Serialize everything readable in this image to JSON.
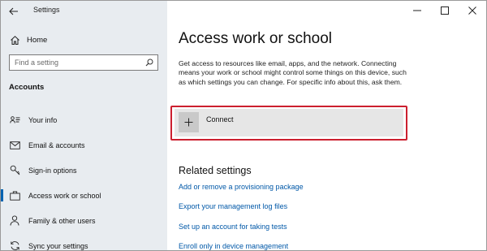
{
  "app": {
    "title": "Settings"
  },
  "sidebar": {
    "home_label": "Home",
    "search": {
      "placeholder": "Find a setting"
    },
    "section_title": "Accounts",
    "items": [
      {
        "label": "Your info",
        "icon": "contact-card-icon"
      },
      {
        "label": "Email & accounts",
        "icon": "mail-icon"
      },
      {
        "label": "Sign-in options",
        "icon": "key-icon"
      },
      {
        "label": "Access work or school",
        "icon": "briefcase-icon",
        "active": true
      },
      {
        "label": "Family & other users",
        "icon": "person-icon"
      },
      {
        "label": "Sync your settings",
        "icon": "sync-icon"
      }
    ]
  },
  "main": {
    "title": "Access work or school",
    "description": "Get access to resources like email, apps, and the network. Connecting means your work or school might control some things on this device, such as which settings you can change. For specific info about this, ask them.",
    "connect_label": "Connect",
    "related": {
      "heading": "Related settings",
      "links": [
        "Add or remove a provisioning package",
        "Export your management log files",
        "Set up an account for taking tests",
        "Enroll only in device management"
      ]
    }
  },
  "colors": {
    "accent": "#0063b1",
    "link": "#0058a8",
    "highlight": "#cc1f2f",
    "sidebar_bg": "#e8ecf0"
  }
}
